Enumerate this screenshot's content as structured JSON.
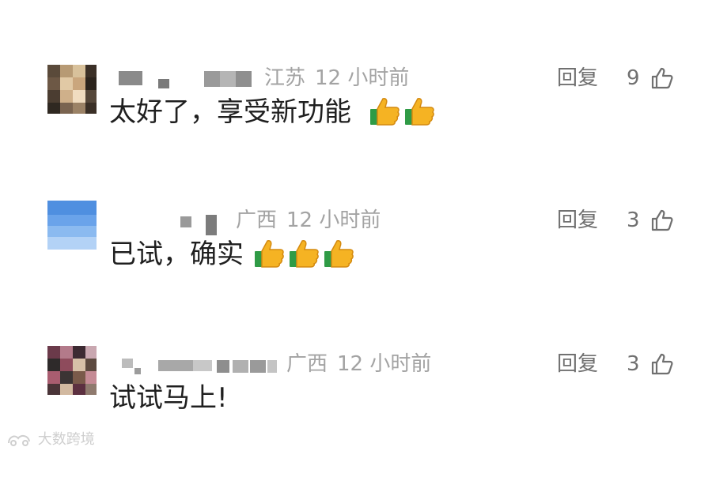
{
  "comments": [
    {
      "location": "江苏",
      "time": "12 小时前",
      "reply_label": "回复",
      "likes": "9",
      "text": "太好了，享受新功能",
      "thumbs_up_emoji_count": 2
    },
    {
      "location": "广西",
      "time": "12 小时前",
      "reply_label": "回复",
      "likes": "3",
      "text": "已试，确实",
      "thumbs_up_emoji_count": 3
    },
    {
      "location": "广西",
      "time": "12 小时前",
      "reply_label": "回复",
      "likes": "3",
      "text": "试试马上!",
      "thumbs_up_emoji_count": 0
    }
  ],
  "watermark": "大数跨境",
  "colors": {
    "meta_text": "#a3a3a3",
    "action_text": "#707070",
    "body_text": "#1f1f1f",
    "thumb_yellow": "#f5b323",
    "thumb_cuff": "#2f9b46"
  },
  "icons": {
    "like": "thumbs-up-outline-icon",
    "emoji": "thumbs-up-emoji-icon",
    "watermark_logo": "dashu-logo-icon"
  }
}
